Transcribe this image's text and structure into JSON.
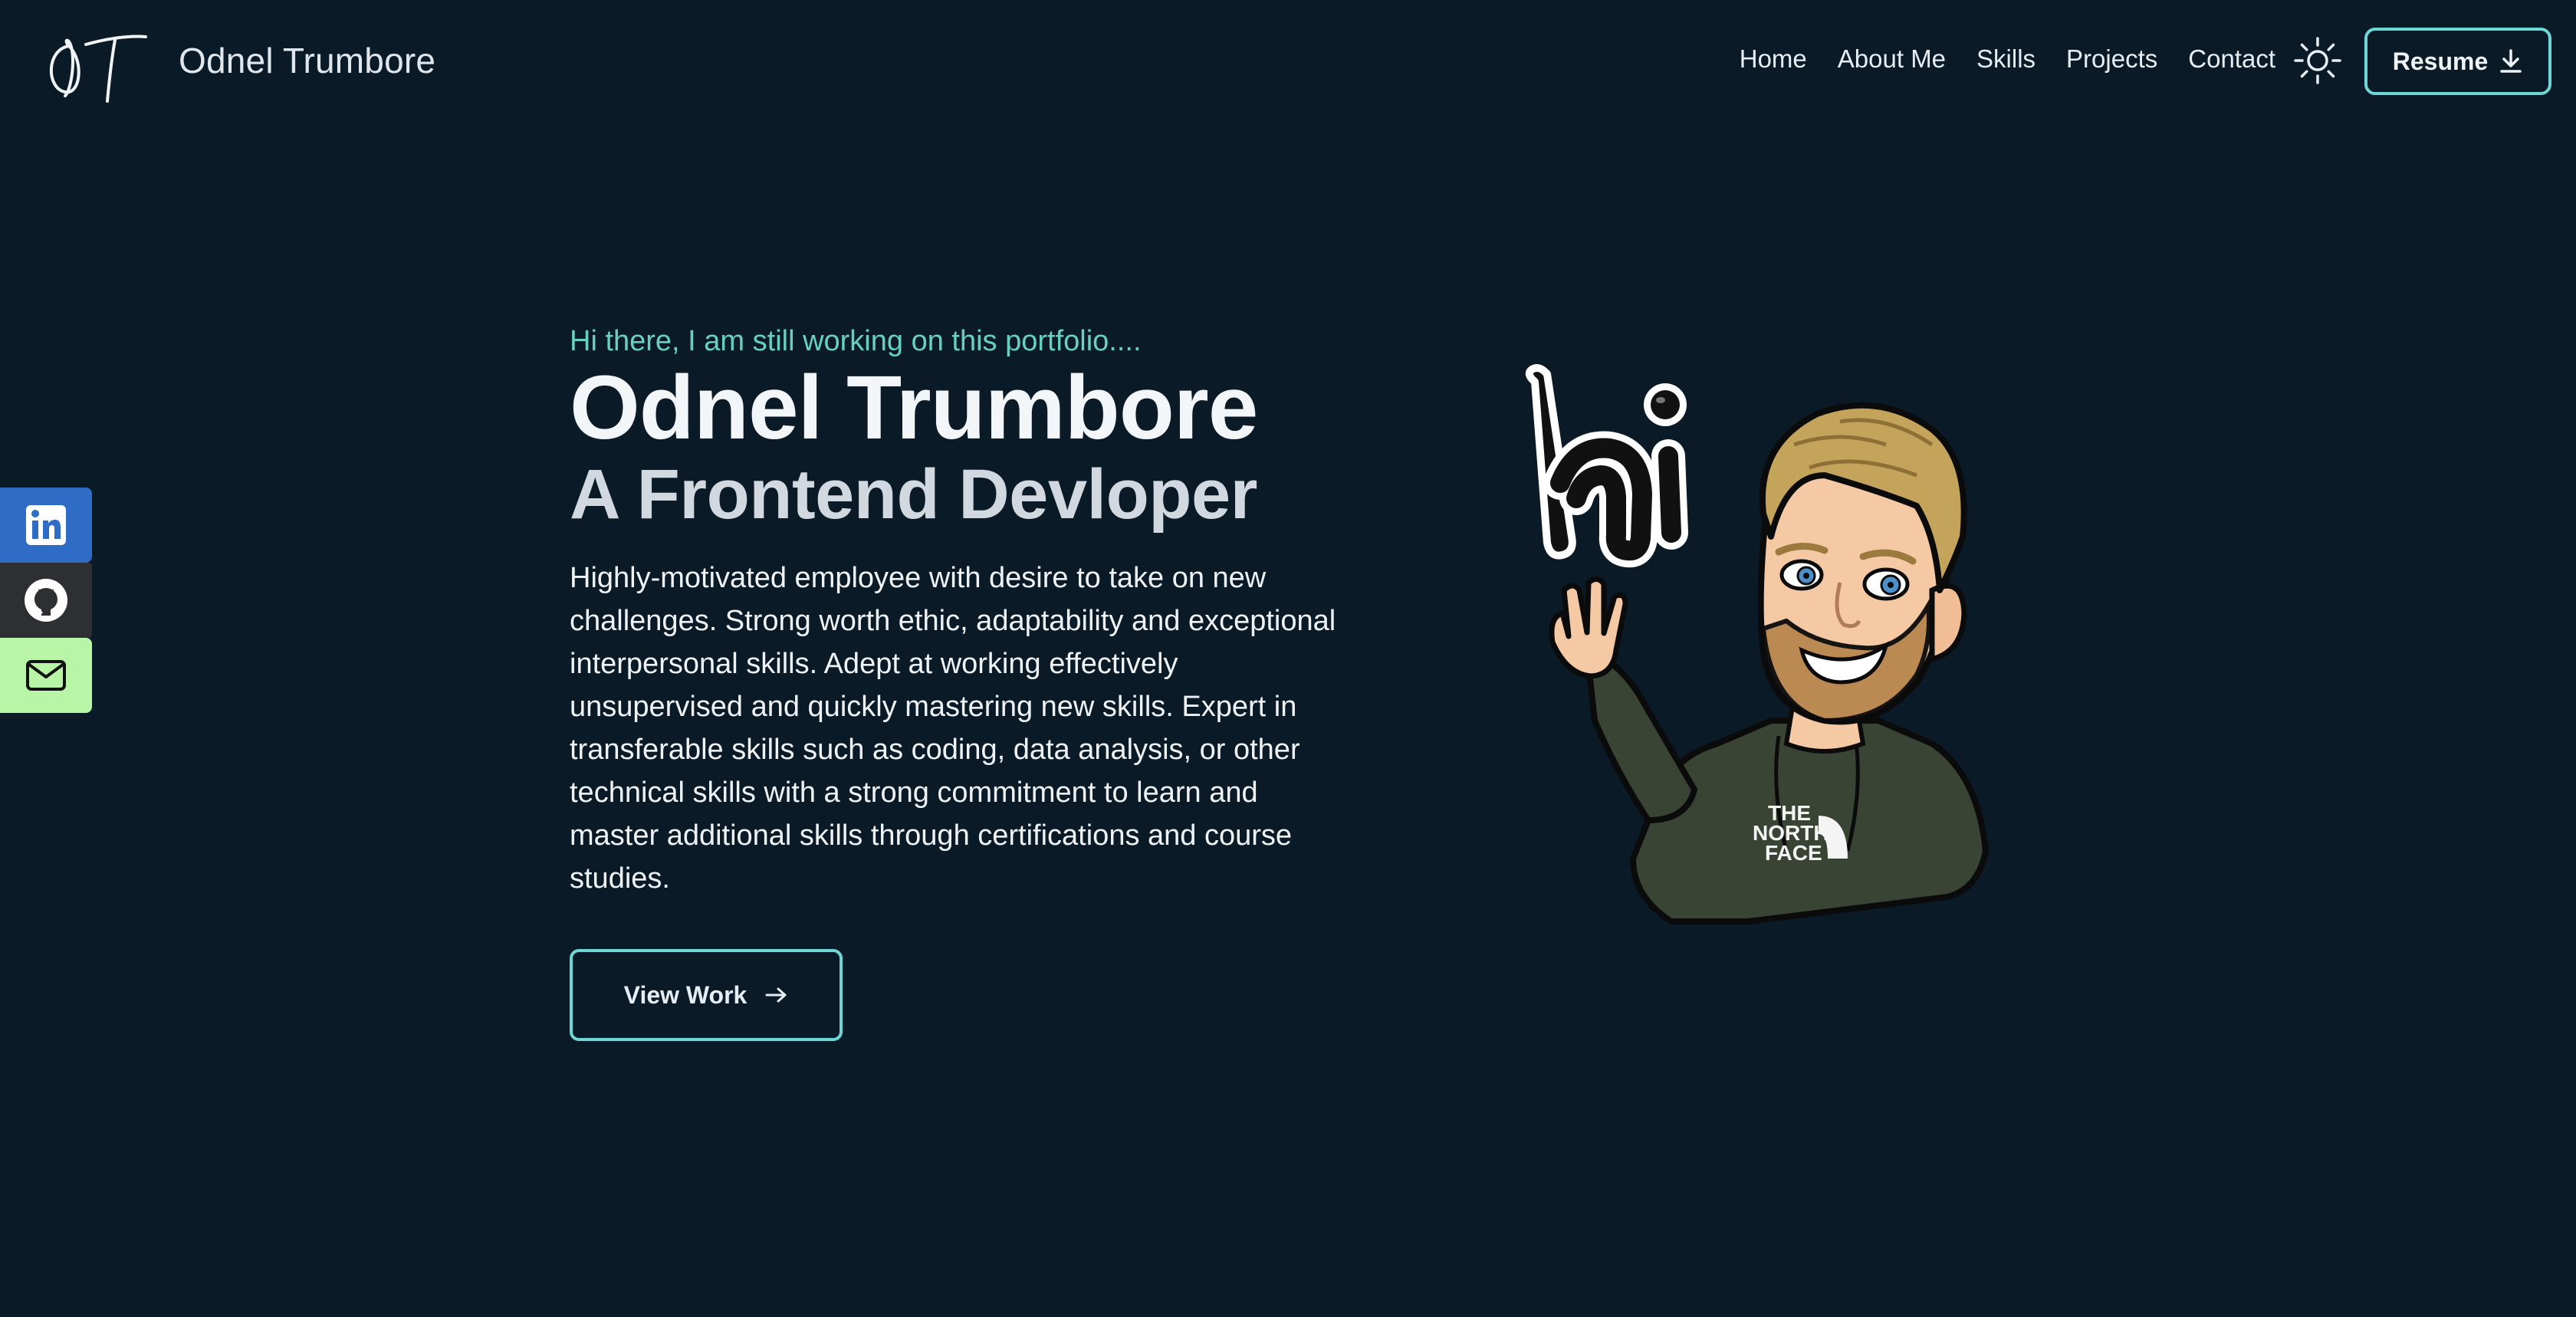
{
  "header": {
    "logo_text": "OT",
    "brand": "Odnel Trumbore",
    "nav": [
      {
        "label": "Home"
      },
      {
        "label": "About Me"
      },
      {
        "label": "Skills"
      },
      {
        "label": "Projects"
      },
      {
        "label": "Contact"
      }
    ],
    "theme_icon": "sun-icon",
    "resume_label": "Resume",
    "resume_icon": "download-icon"
  },
  "social": [
    {
      "name": "linkedin",
      "icon": "linkedin-icon",
      "color": "#2f6cc5"
    },
    {
      "name": "github",
      "icon": "github-icon",
      "color": "#2e2f33"
    },
    {
      "name": "email",
      "icon": "mail-icon",
      "color": "#b9f5a6"
    }
  ],
  "hero": {
    "greeting": "Hi there, I am still working on this portfolio....",
    "name": "Odnel Trumbore",
    "role": "A Frontend Devloper",
    "description": "Highly-motivated employee with desire to take on new challenges. Strong worth ethic, adaptability and exceptional interpersonal skills. Adept at working effectively unsupervised and quickly mastering new skills. Expert in transferable skills such as coding, data analysis, or other technical skills with a strong commitment to learn and master additional skills through certifications and course studies.",
    "cta_label": "View Work",
    "cta_icon": "arrow-right-icon"
  },
  "avatar": {
    "speech": "hi",
    "shirt_text": "THE NORTH FACE"
  },
  "colors": {
    "background": "#0a1a26",
    "accent": "#6fd6d6",
    "greeting": "#66d1c2"
  }
}
